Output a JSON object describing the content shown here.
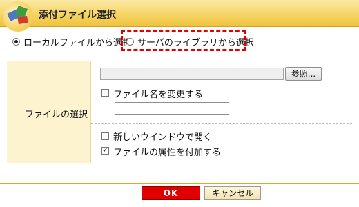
{
  "dialog": {
    "title": "添付ファイル選択"
  },
  "source_options": {
    "local_label": "ローカルファイルから選択",
    "server_label": "サーバのライブラリから選択",
    "selected": "local"
  },
  "form": {
    "row_label": "ファイルの選択",
    "file_path_value": "",
    "browse_label": "参照...",
    "rename_label": "ファイル名を変更する",
    "rename_checked": false,
    "new_name_value": "",
    "new_window_label": "新しいウインドウで開く",
    "new_window_checked": false,
    "add_attr_label": "ファイルの属性を付加する",
    "add_attr_checked": true
  },
  "buttons": {
    "ok_label": "OK",
    "cancel_label": "キャンセル"
  },
  "colors": {
    "title_bar": "#f7d96f",
    "label_cell": "#fdf3cf",
    "highlight": "#e00000",
    "ok_button": "#e00000"
  },
  "icons": {
    "logo": "stacked-books-logo-icon"
  }
}
